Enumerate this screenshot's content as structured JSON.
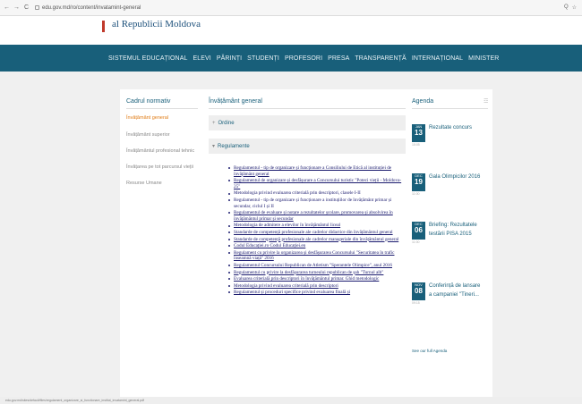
{
  "browser": {
    "url": "edu.gov.md/ro/content/invatamint-general",
    "back_icon": "←",
    "forward_icon": "→",
    "reload_icon": "C",
    "home_icon": "⌂",
    "zoom_icon": "Q",
    "star_icon": "☆"
  },
  "header": {
    "logo_text": "al Republicii Moldova"
  },
  "topnav": [
    "SISTEMUL EDUCAȚIONAL",
    "ELEVI",
    "PĂRINȚI",
    "STUDENȚI",
    "PROFESORI",
    "PRESA",
    "TRANSPARENȚĂ",
    "INTERNAȚIONAL",
    "MINISTER"
  ],
  "sidebar": {
    "title": "Cadrul normativ",
    "items": [
      "Învățământ general",
      "Învățământ superior",
      "Învățământul profesional tehnic",
      "Învățarea pe tot parcursul vieții",
      "Resurse Umane"
    ],
    "active_index": 0
  },
  "main": {
    "title": "Învățământ general",
    "accordions": [
      {
        "label": "Ordine",
        "arrow": "+"
      },
      {
        "label": "Regulamente",
        "arrow": "▾"
      }
    ],
    "items": [
      "Regulamentul - tip de organizare și funcționare a Consiliului de Etică al instituției de învățământ general",
      "Regulamentul de organizare și desfășurare a Concursului turistic \"Poteci vieții - Moldova-25\"",
      "Metodologia privind evaluarea criterială prin descriptori, clasele I-II",
      "Regulamentul - tip de organizare și funcționare a instituțiilor de învățământ primar și secundar, ciclul I și II",
      "Regulamentul de evaluare și notare a rezultatelor școlare, promovarea și absolvirea în învățământul primar și secundar",
      "Metodologia de admitere a elevilor în învățământul liceal",
      "Standarde de competență profesionale ale cadrelor didactice din învățământul general",
      "Standarde de competență profesionale ale cadrelor manageriale din învățământul general",
      "Codul Educației.ro Codul Educației.en",
      "Regulament cu privire la organizarea și desfășurarea Concursului \"Securitatea în trafic înseamnă viață\" 2016",
      "Regulamentul Concursului Republican de Atletism \"Sperantele Olimpice\", anul 2016",
      "Regulamentul cu privire la desfășurarea turneului republican de șah \"Turnul alb\"",
      "Evaluarea criterială prin descriptori în învățământul primar. Ghid metodologic",
      "Metodologia privind evaluarea criterială prin descriptori",
      "Regulamentul și proceduri specifice privind evaluarea finală și"
    ]
  },
  "agenda": {
    "title": "Agenda",
    "rss_icon": "☲",
    "events": [
      {
        "month": "JAN",
        "day": "13",
        "time": "15:05",
        "title": "Rezultate concurs"
      },
      {
        "month": "DEC",
        "day": "19",
        "time": "11:00",
        "title": "Gala Olimpicilor 2016"
      },
      {
        "month": "DEC",
        "day": "06",
        "time": "11:00",
        "title": "Briefing: Rezultatele testării PISA 2015"
      },
      {
        "month": "NOV",
        "day": "08",
        "time": "09:15",
        "title": "Conferință de lansare a campaniei \"Tineri..."
      }
    ],
    "see_all": "See our full Agenda"
  },
  "status": {
    "text": "edu.gov.md/sites/default/files/regulament_organizare_si_functionare_institut_invatamint_general.pdf"
  }
}
